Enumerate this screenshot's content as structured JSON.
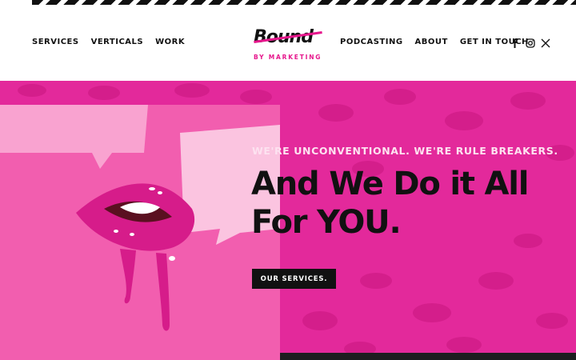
{
  "header": {
    "nav_left": [
      "SERVICES",
      "VERTICALS",
      "WORK"
    ],
    "nav_right": [
      "PODCASTING",
      "ABOUT",
      "GET IN TOUCH"
    ],
    "logo": {
      "word": "Bound",
      "sub": "BY MARKETING"
    },
    "social_icons": [
      "facebook-icon",
      "instagram-icon",
      "x-icon"
    ]
  },
  "hero": {
    "kicker": "WE'RE UNCONVENTIONAL. WE'RE RULE BREAKERS.",
    "headline_line1": "And We Do it All",
    "headline_line2": "For YOU.",
    "cta_label": "OUR SERVICES."
  },
  "colors": {
    "brand_pink": "#e6168c",
    "hero_bg": "#e3299b",
    "panel_pink": "#f25eaf",
    "dark": "#111111"
  }
}
